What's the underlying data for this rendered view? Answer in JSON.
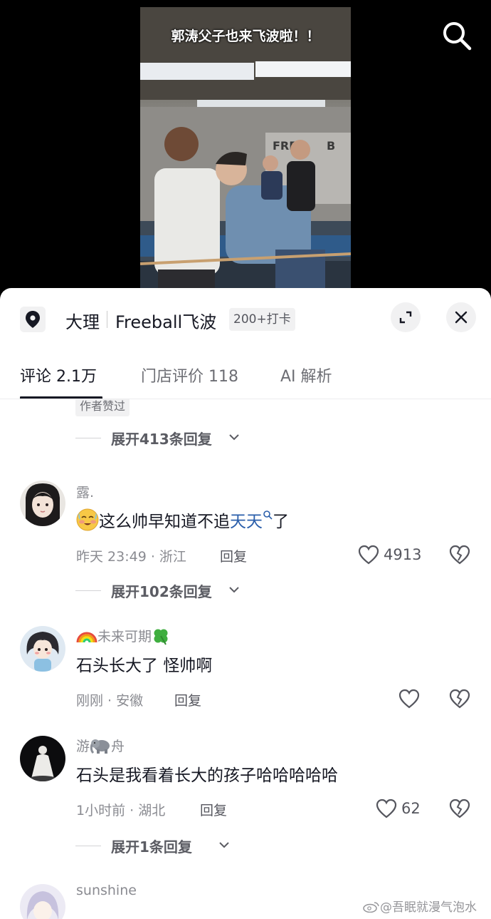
{
  "video": {
    "caption": "郭涛父子也来飞波啦！！"
  },
  "top_bar": {
    "search_icon": "search-icon"
  },
  "location": {
    "city": "大理",
    "place": "Freeball飞波",
    "checkins": "200+打卡",
    "pin_icon": "location-pin-icon",
    "expand_icon": "expand-icon",
    "close_icon": "close-icon"
  },
  "tabs": [
    {
      "label": "评论 2.1万",
      "active": true
    },
    {
      "label": "门店评价 118",
      "active": false
    },
    {
      "label": "AI 解析",
      "active": false
    }
  ],
  "feed": {
    "author_liked_badge": "作者赞过",
    "expand_first": "展开413条回复",
    "comments": [
      {
        "username": "露.",
        "text_before": "这么帅早知道不追",
        "text_link": "天天",
        "text_after": "了",
        "emoji": "blushing-smile-emoji",
        "time_location": "昨天 23:49 · 浙江",
        "reply_label": "回复",
        "likes": "4913",
        "expand_replies": "展开102条回复"
      },
      {
        "username": "未来可期",
        "username_prefix_emoji": "rainbow-emoji",
        "username_suffix_emoji": "four-leaf-clover-emoji",
        "text": "石头长大了 怪帅啊",
        "time_location": "刚刚 · 安徽",
        "reply_label": "回复",
        "likes": ""
      },
      {
        "username_start": "游",
        "username_end": "舟",
        "username_emoji": "elephant-emoji",
        "text": "石头是我看着长大的孩子哈哈哈哈哈",
        "time_location": "1小时前 · 湖北",
        "reply_label": "回复",
        "likes": "62",
        "expand_replies": "展开1条回复"
      },
      {
        "username": "sunshine"
      }
    ]
  },
  "watermark": {
    "text": "@吾眠就漫气泡水"
  },
  "colors": {
    "link": "#2b5fab",
    "text": "#161823",
    "muted": "#8a8b91"
  }
}
